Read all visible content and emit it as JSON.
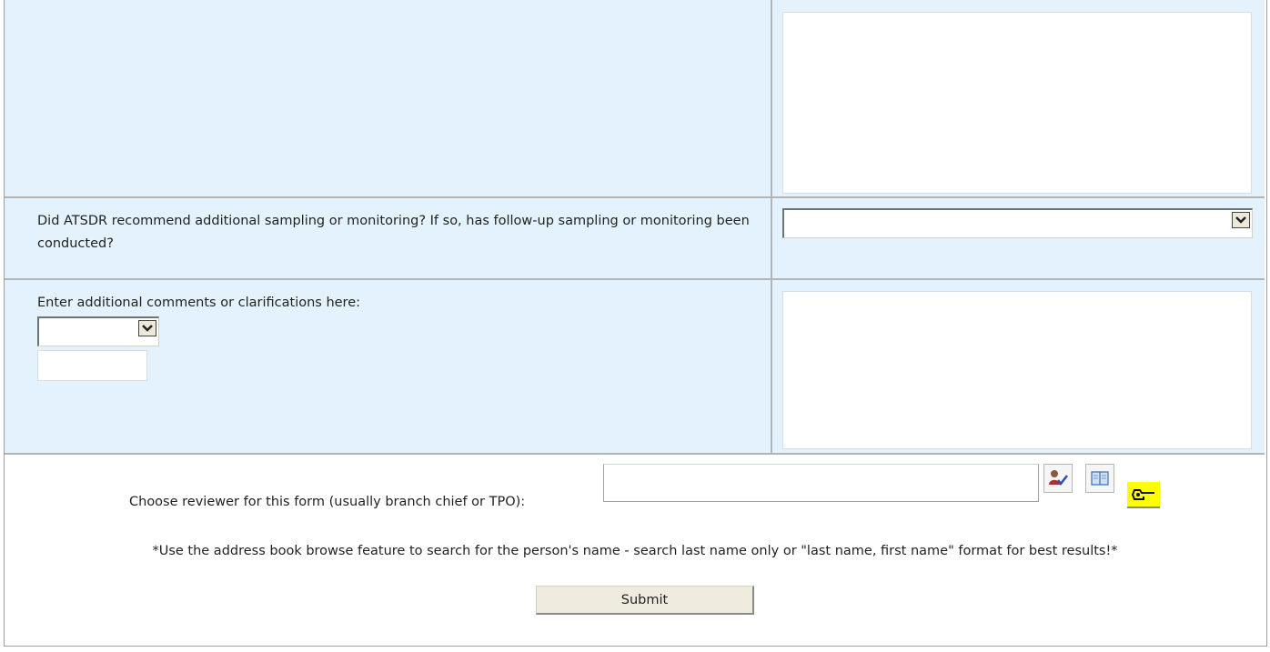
{
  "questions": [
    {
      "label": "Did ATSDR recommend additional sampling or monitoring? If so, has follow-up sampling or monitoring been conducted?",
      "answer": ""
    },
    {
      "label": "Enter additional comments or clarifications here:",
      "select_value": "",
      "input_value": "",
      "answer": ""
    }
  ],
  "reviewer": {
    "label": "Choose reviewer for this form (usually branch chief or TPO):",
    "value": "",
    "note": "*Use the address book browse feature to search for the person's name - search last name only or \"last name, first name\" format for best results!*"
  },
  "submit_label": "Submit",
  "icons": [
    "check-names-icon",
    "address-book-icon",
    "pointing-hand-icon"
  ],
  "colors": {
    "cell_bg": "#e3f2fc",
    "border": "#b4b4b4",
    "highlight": "#ffff00"
  }
}
